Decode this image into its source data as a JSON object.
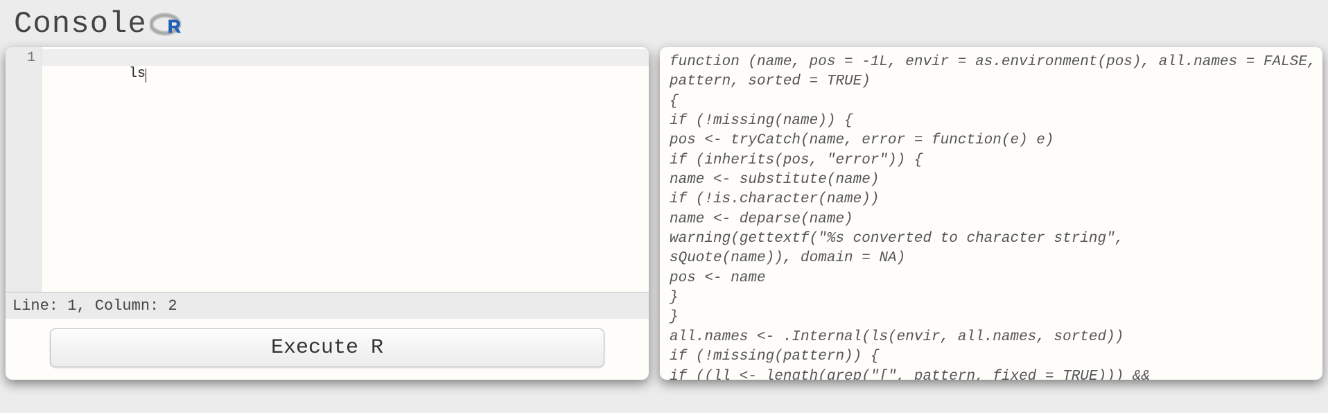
{
  "header": {
    "title": "Console",
    "logo_name": "r-logo"
  },
  "editor": {
    "line_numbers": [
      "1"
    ],
    "code_lines": [
      "ls"
    ],
    "status_text": "Line: 1, Column: 2"
  },
  "actions": {
    "execute_label": "Execute R"
  },
  "output": {
    "lines": [
      "function (name, pos = -1L, envir = as.environment(pos), all.names = FALSE,",
      "pattern, sorted = TRUE)",
      "{",
      "if (!missing(name)) {",
      "pos <- tryCatch(name, error = function(e) e)",
      "if (inherits(pos, \"error\")) {",
      "name <- substitute(name)",
      "if (!is.character(name))",
      "name <- deparse(name)",
      "warning(gettextf(\"%s converted to character string\",",
      "sQuote(name)), domain = NA)",
      "pos <- name",
      "}",
      "}",
      "all.names <- .Internal(ls(envir, all.names, sorted))",
      "if (!missing(pattern)) {",
      "if ((ll <- length(grep(\"[\", pattern, fixed = TRUE))) &&"
    ]
  }
}
